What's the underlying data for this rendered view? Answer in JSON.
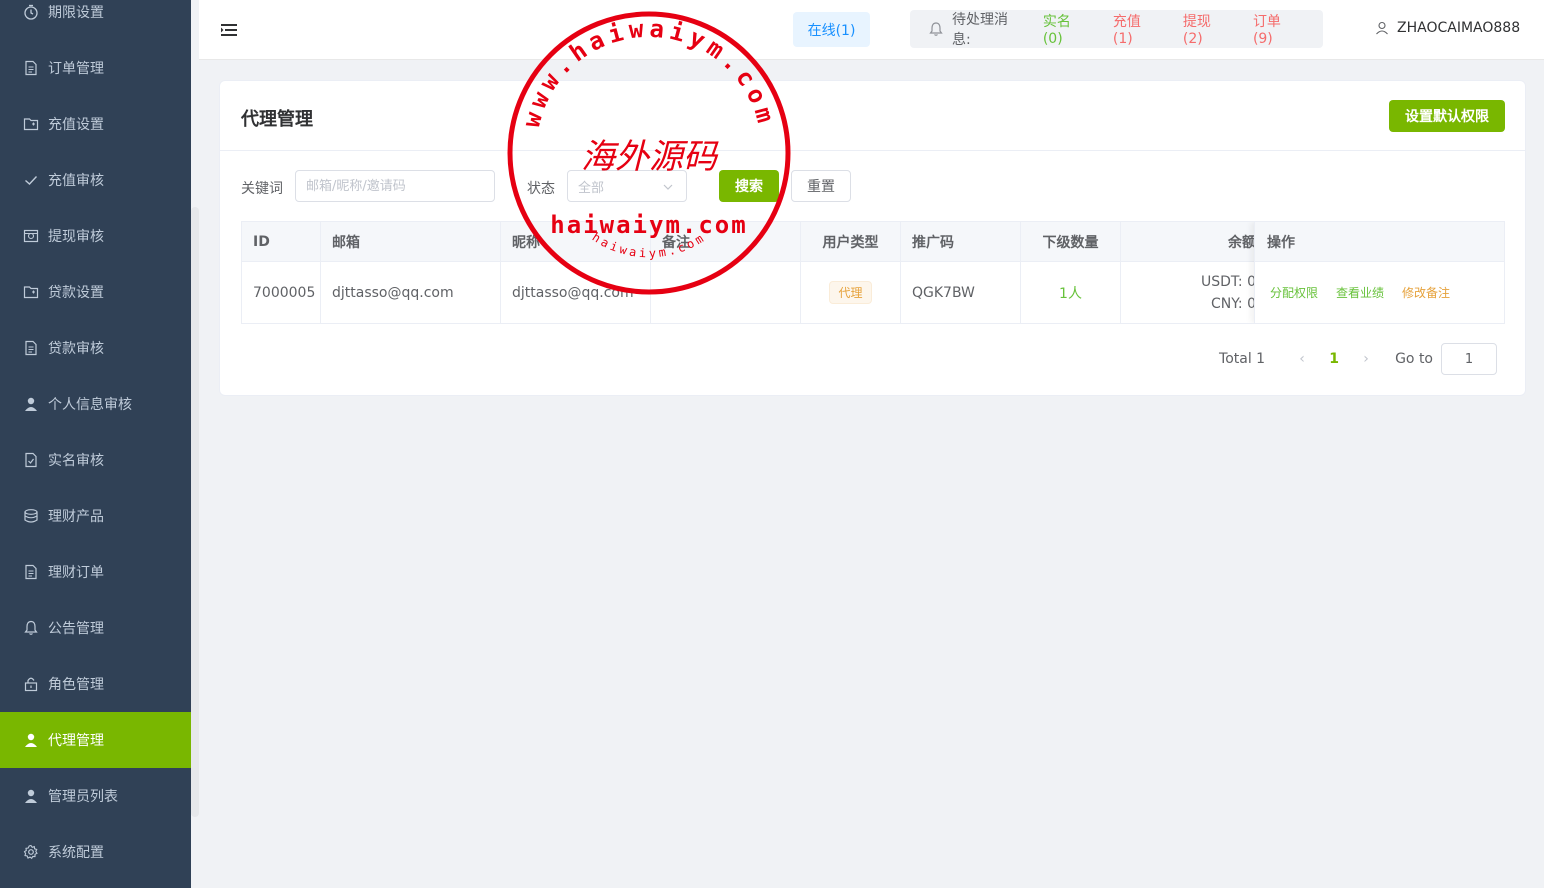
{
  "sidebar": {
    "items": [
      {
        "label": "期限设置",
        "icon": "timer-icon"
      },
      {
        "label": "订单管理",
        "icon": "document-icon"
      },
      {
        "label": "充值设置",
        "icon": "folder-icon"
      },
      {
        "label": "充值审核",
        "icon": "check-icon"
      },
      {
        "label": "提现审核",
        "icon": "wallet-icon"
      },
      {
        "label": "贷款设置",
        "icon": "folder-icon"
      },
      {
        "label": "贷款审核",
        "icon": "document-icon"
      },
      {
        "label": "个人信息审核",
        "icon": "user-icon"
      },
      {
        "label": "实名审核",
        "icon": "document-check-icon"
      },
      {
        "label": "理财产品",
        "icon": "coins-icon"
      },
      {
        "label": "理财订单",
        "icon": "document-icon"
      },
      {
        "label": "公告管理",
        "icon": "bell-icon"
      },
      {
        "label": "角色管理",
        "icon": "lock-icon"
      },
      {
        "label": "代理管理",
        "icon": "user-icon",
        "active": true
      },
      {
        "label": "管理员列表",
        "icon": "user-icon"
      },
      {
        "label": "系统配置",
        "icon": "gear-icon"
      }
    ]
  },
  "header": {
    "online": "在线(1)",
    "pending_label": "待处理消息:",
    "pending_items": [
      {
        "label": "实名(0)",
        "color": "#67c23a"
      },
      {
        "label": "充值(1)",
        "color": "#f56c6c"
      },
      {
        "label": "提现(2)",
        "color": "#f56c6c"
      },
      {
        "label": "订单(9)",
        "color": "#f56c6c"
      }
    ],
    "username": "ZHAOCAIMAO888"
  },
  "page": {
    "title": "代理管理",
    "default_perm_button": "设置默认权限"
  },
  "filter": {
    "keyword_label": "关键词",
    "keyword_placeholder": "邮箱/昵称/邀请码",
    "status_label": "状态",
    "status_value": "全部",
    "search_button": "搜索",
    "reset_button": "重置"
  },
  "table": {
    "columns": [
      "ID",
      "邮箱",
      "昵称",
      "备注",
      "用户类型",
      "推广码",
      "下级数量",
      "余额",
      "操作"
    ],
    "rows": [
      {
        "id": "7000005",
        "email": "djttasso@qq.com",
        "nickname": "djttasso@qq.com",
        "remark": "",
        "user_type": "代理",
        "promo_code": "QGK7BW",
        "sub_count": "1人",
        "balance_usdt": "USDT: 0",
        "balance_cny": "CNY: 0",
        "actions": [
          "分配权限",
          "查看业绩",
          "修改备注"
        ]
      }
    ]
  },
  "pagination": {
    "total": "Total 1",
    "current": "1",
    "goto_label": "Go to",
    "goto_value": "1"
  },
  "watermark": {
    "top_text": "www.haiwaiym.com",
    "center_text": "海外源码",
    "domain_text": "haiwaiym.com",
    "bottom_text": "haiwaiym.com",
    "color": "#e60012"
  },
  "colors": {
    "sidebar_bg": "#304156",
    "accent": "#79b700",
    "warning": "#e6a23c",
    "success": "#67c23a",
    "danger": "#f56c6c"
  }
}
